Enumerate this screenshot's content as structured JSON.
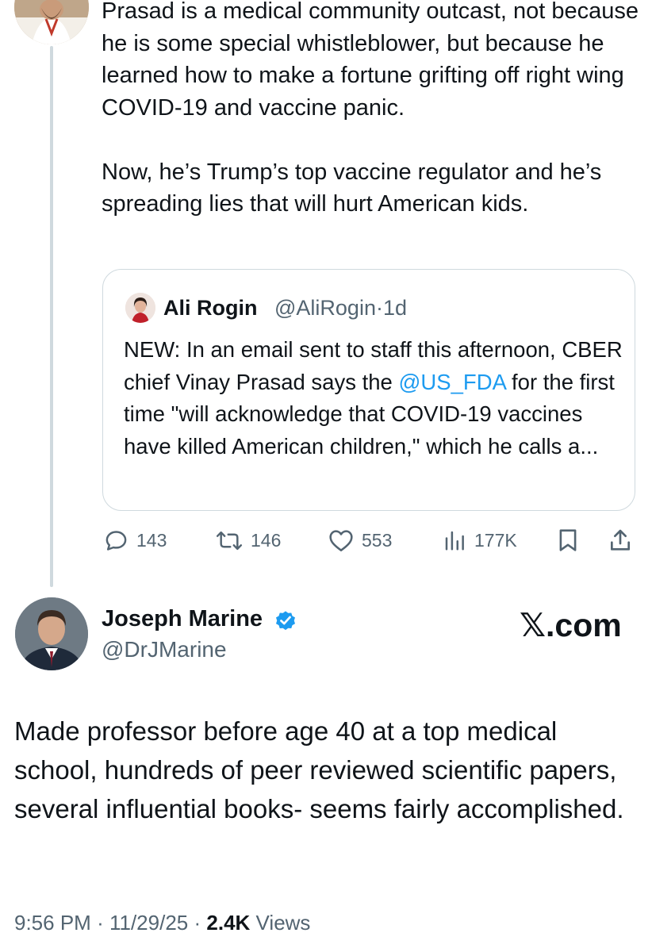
{
  "parent_tweet": {
    "text": "Prasad is a medical community outcast, not because he is some special whistleblower, but because he learned how to make a fortune grifting off right wing COVID-19 and vaccine panic.\n\nNow, he’s Trump’s top vaccine regulator and he’s spreading lies that will hurt American kids.",
    "quote": {
      "author_name": "Ali Rogin",
      "author_handle": "@AliRogin",
      "separator": "·",
      "time": "1d",
      "text_before": "NEW: In an email sent to staff this afternoon, CBER chief Vinay Prasad says the ",
      "mention": "@US_FDA",
      "text_after": " for the first time \"will acknowledge that COVID-19 vaccines have killed American children,\" which he calls a..."
    },
    "actions": {
      "replies": "143",
      "reposts": "146",
      "likes": "553",
      "views": "177K"
    }
  },
  "reply_tweet": {
    "author_name": "Joseph Marine",
    "author_handle": "@DrJMarine",
    "watermark": "𝕏.com",
    "text": "Made professor before age 40 at a top medical school, hundreds of peer reviewed scientific papers, several influential books- seems fairly accomplished.",
    "time": "9:56 PM",
    "date": "11/29/25",
    "separator": "·",
    "views_count": "2.4K",
    "views_label": "Views"
  },
  "colors": {
    "text": "#0f1419",
    "secondary": "#536471",
    "accent": "#1d9bf0",
    "border": "#cfd9de"
  },
  "icons": [
    "reply-icon",
    "repost-icon",
    "like-icon",
    "views-icon",
    "bookmark-icon",
    "share-icon",
    "verified-badge-icon"
  ]
}
